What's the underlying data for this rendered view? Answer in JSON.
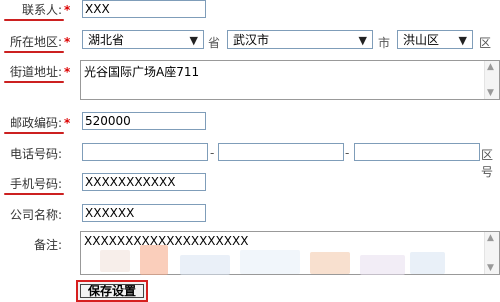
{
  "form": {
    "contact": {
      "label": "联系人:",
      "required": "*",
      "value": "XXX"
    },
    "region": {
      "label": "所在地区:",
      "required": "*",
      "province": "湖北省",
      "province_unit": "省",
      "city": "武汉市",
      "city_unit": "市",
      "district": "洪山区",
      "district_unit": "区"
    },
    "street": {
      "label": "街道地址:",
      "required": "*",
      "value": "光谷国际广场A座711"
    },
    "postal": {
      "label": "邮政编码:",
      "required": "*",
      "value": "520000"
    },
    "phone": {
      "label": "电话号码:",
      "dash1": "-",
      "dash2": "-",
      "suffix": "区号"
    },
    "mobile": {
      "label": "手机号码:",
      "value": "XXXXXXXXXXX"
    },
    "company": {
      "label": "公司名称:",
      "value": "XXXXXX"
    },
    "remark": {
      "label": "备注:",
      "value": "XXXXXXXXXXXXXXXXXXXX"
    },
    "save_button": "保存设置"
  },
  "colors": {
    "required": "#dd0000",
    "highlight": "#cc2020",
    "border": "#7f9db9"
  },
  "icons": {
    "dropdown": "chevron-down-icon",
    "scroll_up": "scroll-up-icon",
    "scroll_down": "scroll-down-icon"
  }
}
